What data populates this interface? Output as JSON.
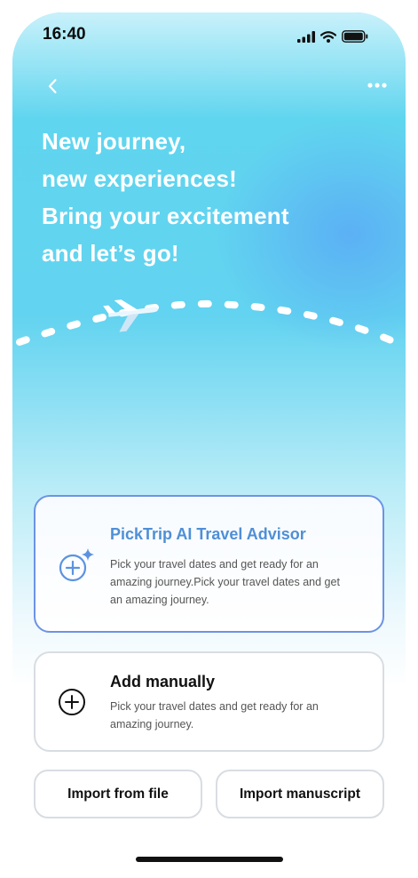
{
  "status_bar": {
    "time": "16:40",
    "icons": [
      "cellular-signal-icon",
      "wifi-icon",
      "battery-icon"
    ]
  },
  "nav": {
    "back_icon": "chevron-left-icon",
    "more_icon": "more-horizontal-icon"
  },
  "hero": {
    "lines": [
      "New journey,",
      "new experiences!",
      "Bring your excitement",
      "and let’s go!"
    ]
  },
  "illustration": {
    "icon": "airplane-icon"
  },
  "options": {
    "ai": {
      "title": "PickTrip AI Travel Advisor",
      "description": "Pick your travel dates and get ready for an amazing journey.Pick your travel dates and get an amazing journey.",
      "icon": "add-sparkle-icon",
      "accent": "#4f8fd6"
    },
    "manual": {
      "title": "Add manually",
      "description": "Pick your travel dates and get ready for an amazing journey.",
      "icon": "add-circle-icon"
    }
  },
  "actions": {
    "import_file": "Import from file",
    "import_manuscript": "Import manuscript"
  },
  "colors": {
    "gradient_top": "#5fd6ee",
    "gradient_accent": "#5aaaf5",
    "card_border_ai": "#6c93e5",
    "card_border": "#d8dde2"
  }
}
